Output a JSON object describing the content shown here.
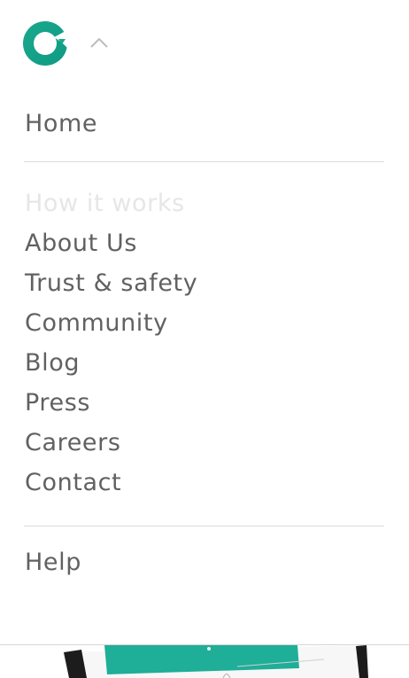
{
  "header": {
    "logo_icon": "refresh-circle-logo",
    "collapse_icon": "chevron-up-icon",
    "brand_color": "#1aa68b"
  },
  "menu": {
    "primary": [
      {
        "label": "Home"
      }
    ],
    "section_heading": "How it works",
    "links": [
      {
        "label": "About Us"
      },
      {
        "label": "Trust & safety"
      },
      {
        "label": "Community"
      },
      {
        "label": "Blog"
      },
      {
        "label": "Press"
      },
      {
        "label": "Careers"
      },
      {
        "label": "Contact"
      }
    ],
    "footer_links": [
      {
        "label": "Help"
      }
    ]
  },
  "colors": {
    "text": "#616161",
    "heading_muted": "#e6e6e6",
    "divider": "#dcdcdc",
    "accent_teal": "#1fae98"
  }
}
